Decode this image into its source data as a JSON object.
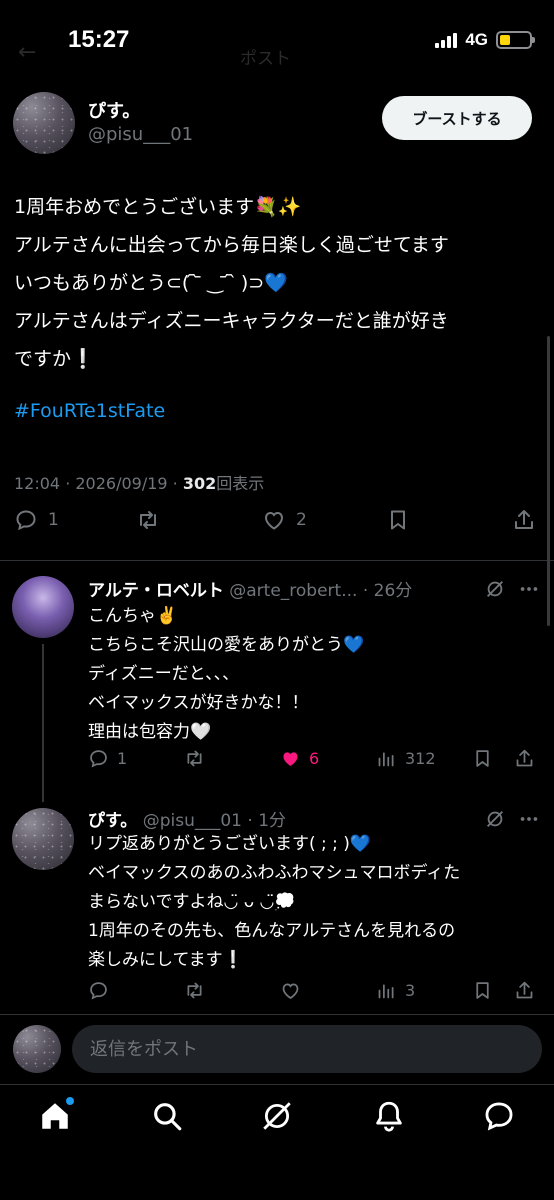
{
  "status_bar": {
    "time": "15:27",
    "network": "4G",
    "battery_level": 0.35,
    "ghost_title": "ポスト"
  },
  "main_post": {
    "author_name": "ぴす。",
    "author_handle": "@pisu___01",
    "boost_label": "ブーストする",
    "text": "1周年おめでとうございます💐✨\nアルテさんに出会ってから毎日楽しく過ごせてます\nいつもありがとう⊂( ᷇ ᷅ ‿ ᷄ ᷆ )⊃💙\nアルテさんはディズニーキャラクターだと誰が好き\nですか❕",
    "hashtag": "#FouRTe1stFate",
    "meta_time": "12:04 · 2026/09/19 · ",
    "view_count": "302",
    "view_label": "回表示",
    "reply_count": "1",
    "like_count": "2"
  },
  "replies": [
    {
      "author_name": "アルテ・ロベルト",
      "author_handle": "@arte_robert... · 26分",
      "text": "こんちゃ✌️\nこちらこそ沢山の愛をありがとう💙\nディズニーだと、、、\nベイマックスが好きかな！！\n理由は包容力🤍",
      "reply_count": "1",
      "like_count": "6",
      "view_count": "312"
    },
    {
      "author_name": "ぴす。",
      "author_handle": "@pisu___01 · 1分",
      "text": "リプ返ありがとうございます( ; ; )💙\nベイマックスのあのふわふわマシュマロボディた\nまらないですよね◡̈ ᴗ ◡̈💭\n1周年のその先も、色んなアルテさんを見れるの\n楽しみにしてます❕",
      "view_count": "3"
    }
  ],
  "composer": {
    "placeholder": "返信をポスト"
  },
  "colors": {
    "accent": "#1d9bf0",
    "like_active": "#f91880",
    "background": "#000000"
  },
  "icons": [
    "reply-icon",
    "repost-icon",
    "like-icon",
    "bookmark-icon",
    "share-icon",
    "grok-icon",
    "more-icon",
    "home-icon",
    "search-icon",
    "notifications-icon",
    "messages-icon"
  ]
}
